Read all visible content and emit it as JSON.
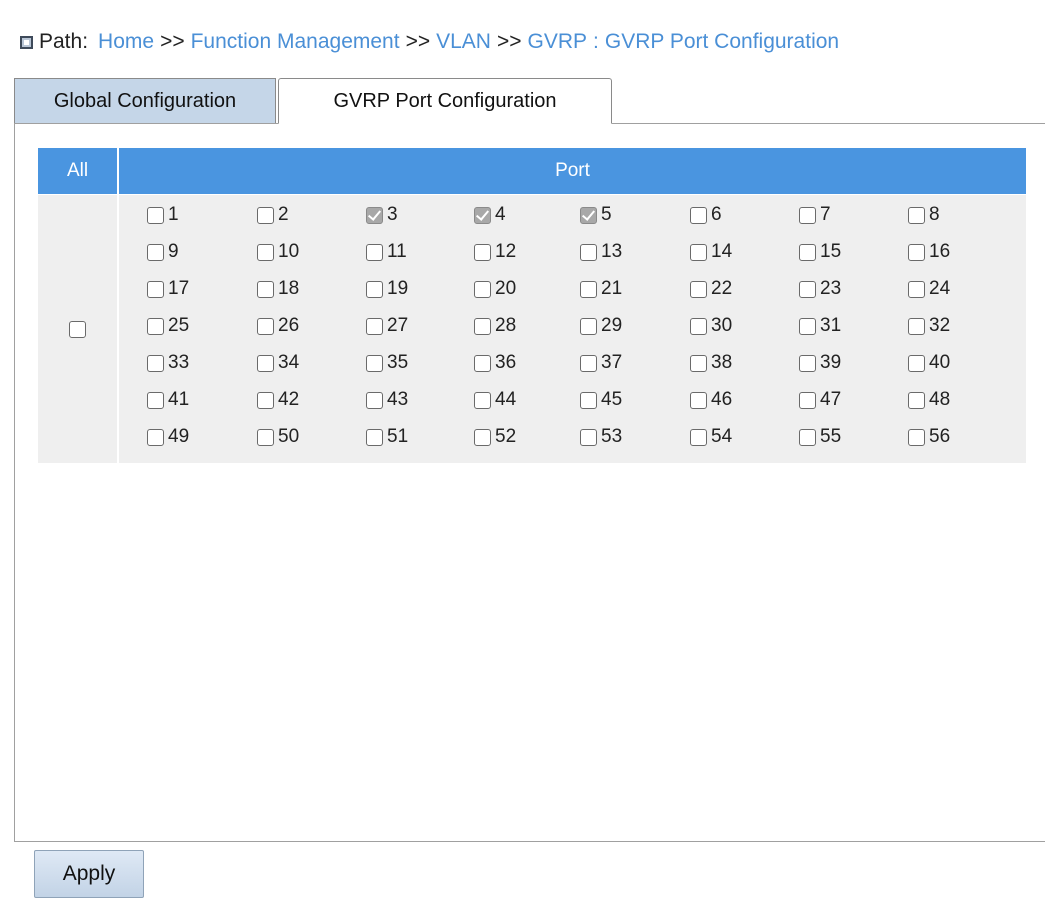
{
  "path": {
    "label": "Path:",
    "crumbs": [
      "Home",
      "Function Management",
      "VLAN",
      "GVRP"
    ],
    "separator": ">>",
    "colon": ":",
    "current": "GVRP Port Configuration"
  },
  "tabs": [
    {
      "label": "Global Configuration",
      "active": false
    },
    {
      "label": "GVRP Port Configuration",
      "active": true
    }
  ],
  "table": {
    "header_all": "All",
    "header_port": "Port",
    "all_checked": false,
    "ports": [
      {
        "label": "1",
        "checked": false
      },
      {
        "label": "2",
        "checked": false
      },
      {
        "label": "3",
        "checked": true
      },
      {
        "label": "4",
        "checked": true
      },
      {
        "label": "5",
        "checked": true
      },
      {
        "label": "6",
        "checked": false
      },
      {
        "label": "7",
        "checked": false
      },
      {
        "label": "8",
        "checked": false
      },
      {
        "label": "9",
        "checked": false
      },
      {
        "label": "10",
        "checked": false
      },
      {
        "label": "11",
        "checked": false
      },
      {
        "label": "12",
        "checked": false
      },
      {
        "label": "13",
        "checked": false
      },
      {
        "label": "14",
        "checked": false
      },
      {
        "label": "15",
        "checked": false
      },
      {
        "label": "16",
        "checked": false
      },
      {
        "label": "17",
        "checked": false
      },
      {
        "label": "18",
        "checked": false
      },
      {
        "label": "19",
        "checked": false
      },
      {
        "label": "20",
        "checked": false
      },
      {
        "label": "21",
        "checked": false
      },
      {
        "label": "22",
        "checked": false
      },
      {
        "label": "23",
        "checked": false
      },
      {
        "label": "24",
        "checked": false
      },
      {
        "label": "25",
        "checked": false
      },
      {
        "label": "26",
        "checked": false
      },
      {
        "label": "27",
        "checked": false
      },
      {
        "label": "28",
        "checked": false
      },
      {
        "label": "29",
        "checked": false
      },
      {
        "label": "30",
        "checked": false
      },
      {
        "label": "31",
        "checked": false
      },
      {
        "label": "32",
        "checked": false
      },
      {
        "label": "33",
        "checked": false
      },
      {
        "label": "34",
        "checked": false
      },
      {
        "label": "35",
        "checked": false
      },
      {
        "label": "36",
        "checked": false
      },
      {
        "label": "37",
        "checked": false
      },
      {
        "label": "38",
        "checked": false
      },
      {
        "label": "39",
        "checked": false
      },
      {
        "label": "40",
        "checked": false
      },
      {
        "label": "41",
        "checked": false
      },
      {
        "label": "42",
        "checked": false
      },
      {
        "label": "43",
        "checked": false
      },
      {
        "label": "44",
        "checked": false
      },
      {
        "label": "45",
        "checked": false
      },
      {
        "label": "46",
        "checked": false
      },
      {
        "label": "47",
        "checked": false
      },
      {
        "label": "48",
        "checked": false
      },
      {
        "label": "49",
        "checked": false
      },
      {
        "label": "50",
        "checked": false
      },
      {
        "label": "51",
        "checked": false
      },
      {
        "label": "52",
        "checked": false
      },
      {
        "label": "53",
        "checked": false
      },
      {
        "label": "54",
        "checked": false
      },
      {
        "label": "55",
        "checked": false
      },
      {
        "label": "56",
        "checked": false
      }
    ]
  },
  "buttons": {
    "apply": "Apply"
  }
}
